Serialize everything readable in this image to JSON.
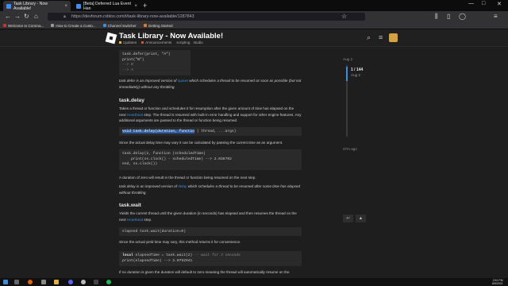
{
  "browser": {
    "tabs": [
      {
        "label": "Task Library - Now Available!",
        "active": true
      },
      {
        "label": "[Beta] Deferred Lua Event Han",
        "active": false
      }
    ],
    "new_tab_label": "+",
    "window_controls": [
      "—",
      "□",
      "✕"
    ],
    "url": "https://devforum.roblox.com/t/task-library-now-available/1287843",
    "bookmarks": [
      "Welcome to Comma...",
      "How to Create a Custo...",
      "Channel Switcher",
      "Getting Started"
    ]
  },
  "forum_header": {
    "title": "Task Library - Now Available!",
    "categories": [
      "Updates",
      "Announcements"
    ],
    "tags": [
      "scripting",
      "studio"
    ]
  },
  "post": {
    "code_defer": [
      "task.defer(print, \"A\")",
      "print(\"B\")",
      "--> B",
      "--> A"
    ],
    "defer_note_1": "task.defer is an improved version of ",
    "defer_note_link": "spawn",
    "defer_note_2": " which schedules a thread to be resumed as soon as possible (but not immediately) without any throttling.",
    "h_delay": "task.delay",
    "delay_desc_1": "Takes a thread or function and schedules it for resumption after the given amount of time has elapsed on the next ",
    "delay_desc_link": "Heartbeat",
    "delay_desc_2": " step. The thread is resumed with built-in error handling and support for other engine features. Any additional arguments are passed to the thread or function being resumed.",
    "sig_delay_sel": "void task.delay(duration, functio",
    "sig_delay_rest": "| thread, ...args)",
    "delay_actual": "Since the actual delay time may vary it can be calculated by passing the current time as an argument.",
    "code_delay": [
      "task.delay(2, function (scheduledTime)",
      "    print(os.clock() - scheduledTime) --> 2.038702",
      "end, os.clock())"
    ],
    "delay_zero": "A duration of zero will result in the thread or function being resumed on the next step.",
    "delay_note_1": "task.delay is an improved version of ",
    "delay_note_link": "delay",
    "delay_note_2": " which schedules a thread to be resumed after some time has elapsed without throttling.",
    "h_wait": "task.wait",
    "wait_desc_1": "Yields the current thread until the given duration (in seconds) has elapsed and then resumes the thread on the next ",
    "wait_desc_link": "Heartbeat",
    "wait_desc_2": " step.",
    "sig_wait": "elapsed task.wait(duration=0)",
    "wait_actual": "Since the actual yield time may vary, this method returns it for convenience.",
    "code_wait_1a": "local",
    "code_wait_1b": " elapsedTime = task.wait(2) ",
    "code_wait_1c": "-- wait for 2 seconds",
    "code_wait_2": "print(elapsedTime) --> 2.0792941",
    "wait_zero": "If no duration is given the duration will default to zero meaning the thread will automatically resume on the"
  },
  "timeline": {
    "top_date": "Aug 2",
    "position": "1 / 144",
    "position_date": "Aug 2",
    "bottom_label": "27m ago",
    "progress_fraction": 0.0069
  },
  "taskbar": {
    "time": "2:51 PM",
    "date": "8/5/2021"
  },
  "colors": {
    "accent": "#3b8edb",
    "background": "#1e1e1e",
    "selection": "#2f5d9e"
  }
}
